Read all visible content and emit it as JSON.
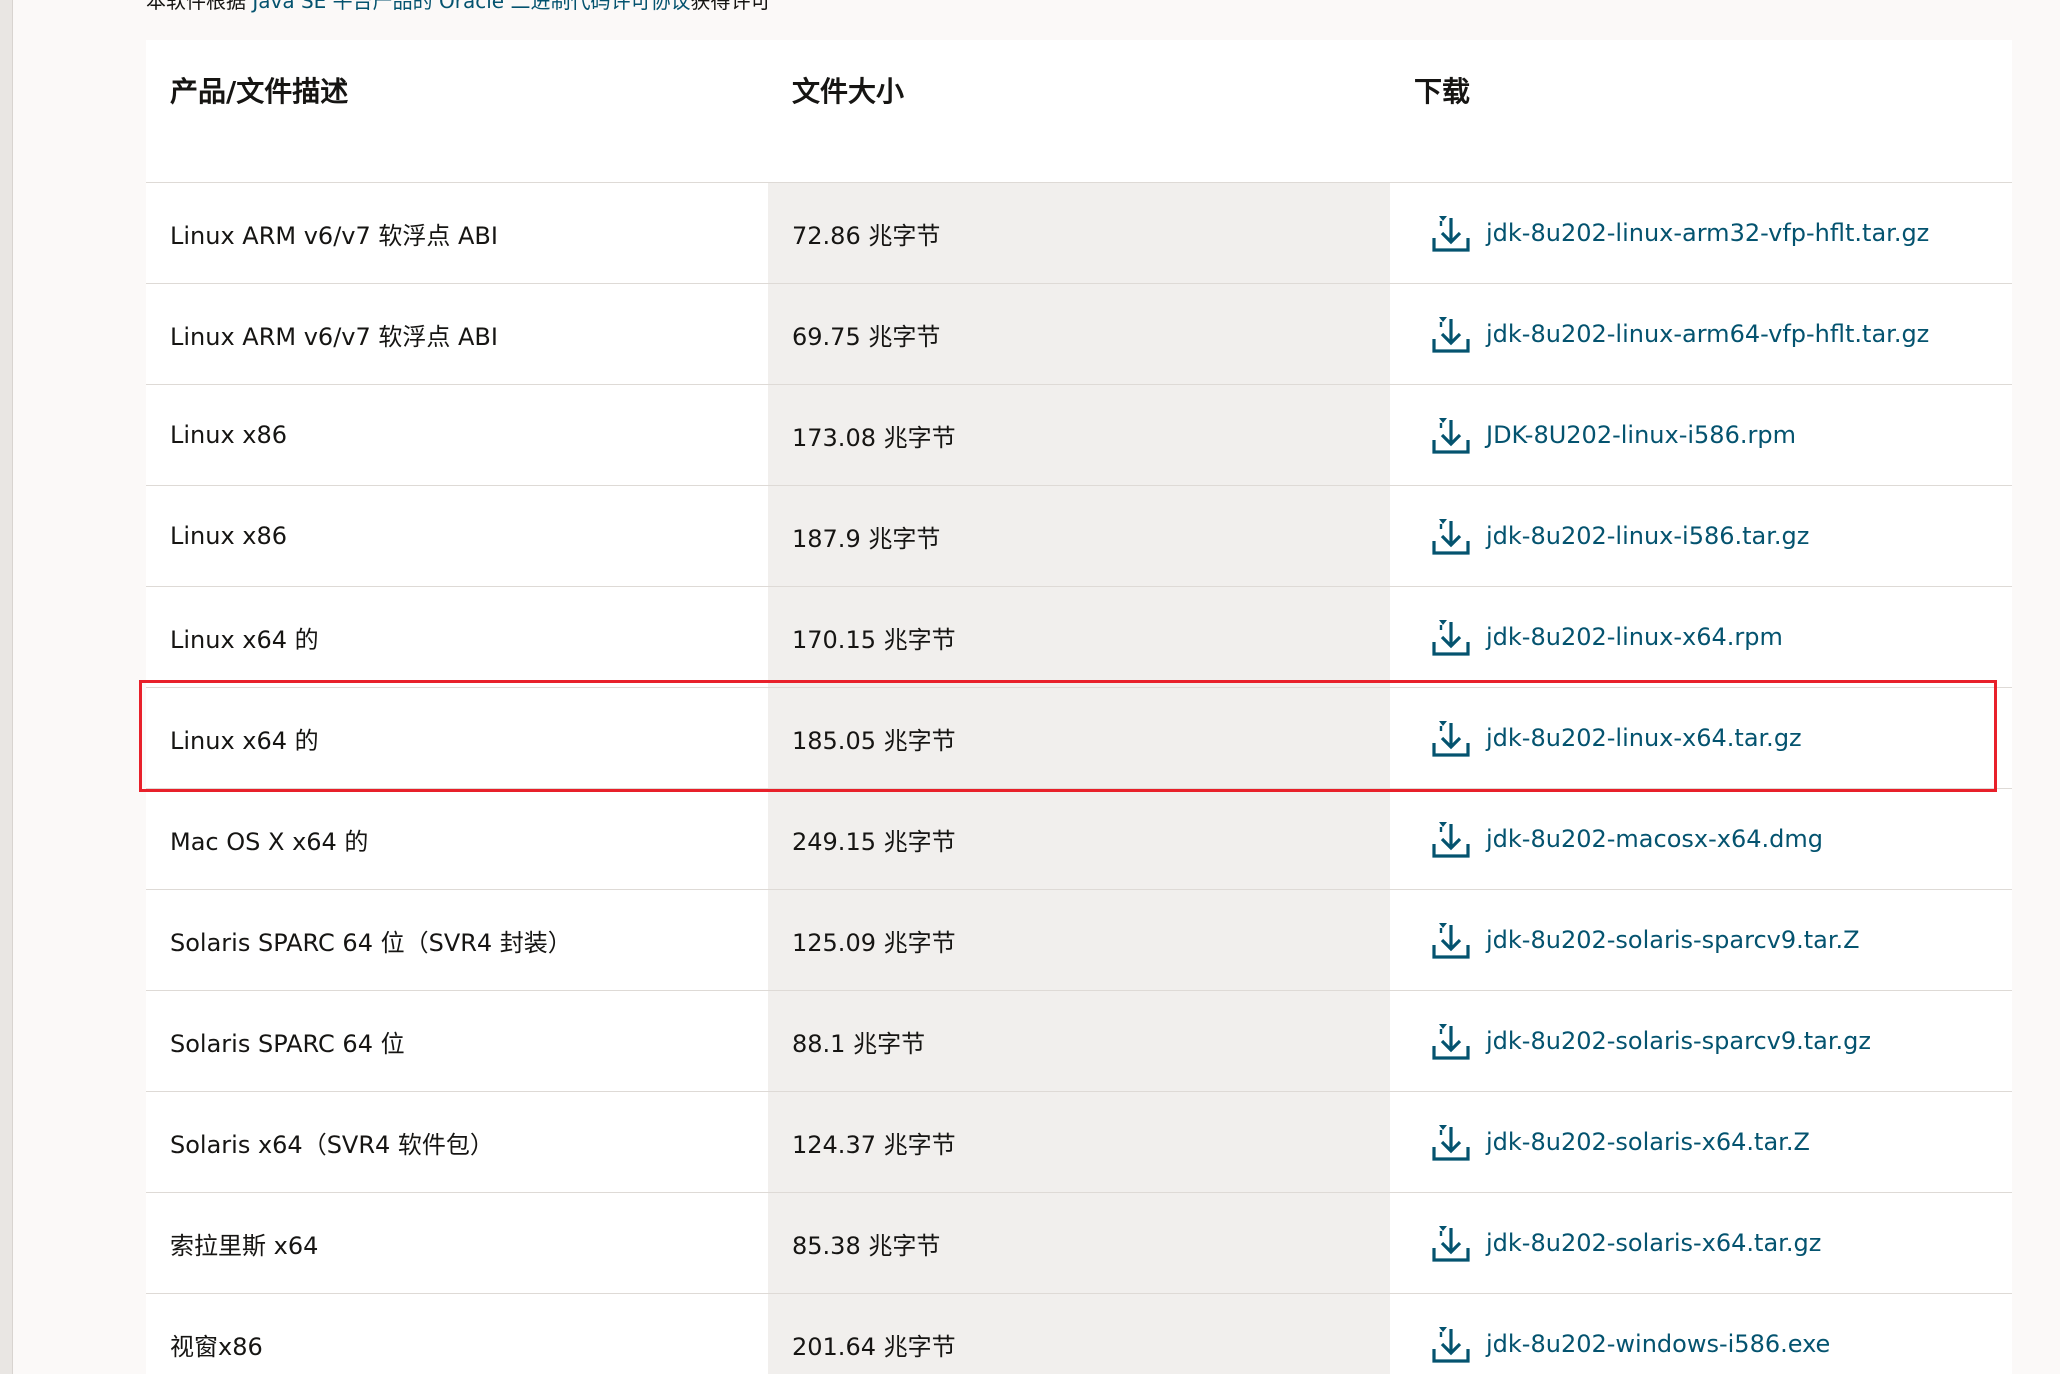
{
  "license_note": {
    "prefix": "本软件根据 ",
    "link": "Java SE 平台产品的 Oracle 二进制代码许可协议",
    "suffix": "获得许可"
  },
  "table": {
    "headers": [
      "产品/文件描述",
      "文件大小",
      "下载"
    ],
    "rows": [
      {
        "desc": "Linux ARM v6/v7 软浮点 ABI",
        "size": "72.86 兆字节",
        "file": "jdk-8u202-linux-arm32-vfp-hflt.tar.gz"
      },
      {
        "desc": "Linux ARM v6/v7 软浮点 ABI",
        "size": "69.75 兆字节",
        "file": "jdk-8u202-linux-arm64-vfp-hflt.tar.gz"
      },
      {
        "desc": "Linux x86",
        "size": "173.08 兆字节",
        "file": "JDK-8U202-linux-i586.rpm"
      },
      {
        "desc": "Linux x86",
        "size": "187.9 兆字节",
        "file": "jdk-8u202-linux-i586.tar.gz"
      },
      {
        "desc": "Linux x64 的",
        "size": "170.15 兆字节",
        "file": "jdk-8u202-linux-x64.rpm"
      },
      {
        "desc": "Linux x64 的",
        "size": "185.05 兆字节",
        "file": "jdk-8u202-linux-x64.tar.gz"
      },
      {
        "desc": "Mac OS X x64 的",
        "size": "249.15 兆字节",
        "file": "jdk-8u202-macosx-x64.dmg"
      },
      {
        "desc": "Solaris SPARC 64 位（SVR4 封装）",
        "size": "125.09 兆字节",
        "file": "jdk-8u202-solaris-sparcv9.tar.Z"
      },
      {
        "desc": "Solaris SPARC 64 位",
        "size": "88.1 兆字节",
        "file": "jdk-8u202-solaris-sparcv9.tar.gz"
      },
      {
        "desc": "Solaris x64（SVR4 软件包）",
        "size": "124.37 兆字节",
        "file": "jdk-8u202-solaris-x64.tar.Z"
      },
      {
        "desc": "索拉里斯 x64",
        "size": "85.38 兆字节",
        "file": "jdk-8u202-solaris-x64.tar.gz"
      },
      {
        "desc": "视窗x86",
        "size": "201.64 兆字节",
        "file": "jdk-8u202-windows-i586.exe"
      }
    ]
  },
  "icons": {
    "download": "download-icon"
  },
  "colors": {
    "link": "#04536f",
    "highlight": "#e8202a",
    "size_column_bg": "#f1efed"
  },
  "highlighted_row_index": 5
}
